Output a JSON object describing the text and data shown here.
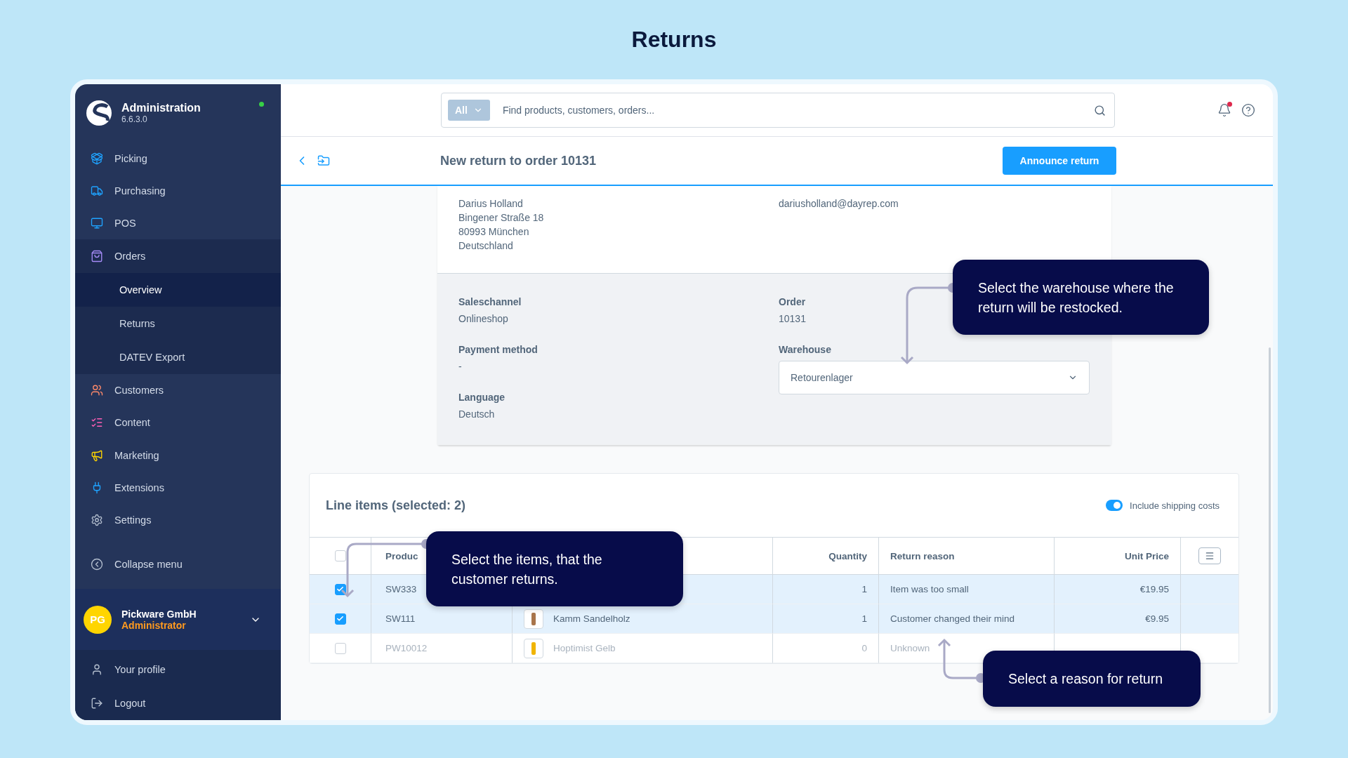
{
  "page_title": "Returns",
  "sidebar": {
    "app_name": "Administration",
    "version": "6.6.3.0",
    "online": true,
    "items": [
      {
        "label": "Picking",
        "selected": false
      },
      {
        "label": "Purchasing",
        "selected": false
      },
      {
        "label": "POS",
        "selected": false
      },
      {
        "label": "Orders",
        "selected": false,
        "expanded": true,
        "children": [
          {
            "label": "Overview",
            "selected": true
          },
          {
            "label": "Returns",
            "selected": false
          },
          {
            "label": "DATEV Export",
            "selected": false
          }
        ]
      },
      {
        "label": "Customers",
        "selected": false
      },
      {
        "label": "Content",
        "selected": false
      },
      {
        "label": "Marketing",
        "selected": false
      },
      {
        "label": "Extensions",
        "selected": false
      },
      {
        "label": "Settings",
        "selected": false
      }
    ],
    "collapse": "Collapse menu",
    "user": {
      "initials": "PG",
      "name": "Pickware GmbH",
      "role": "Administrator"
    },
    "user_links": [
      "Your profile",
      "Logout"
    ]
  },
  "search": {
    "scope": "All",
    "placeholder": "Find products, customers, orders..."
  },
  "notifications": {
    "unread": true
  },
  "header": {
    "title": "New return to order 10131",
    "button": "Announce return"
  },
  "address": {
    "lines": [
      "Darius Holland",
      "Bingener Straße 18",
      "80993 München",
      "Deutschland"
    ],
    "email": "dariusholland@dayrep.com"
  },
  "details": {
    "left": [
      {
        "label": "Saleschannel",
        "value": "Onlineshop"
      },
      {
        "label": "Payment method",
        "value": "-"
      },
      {
        "label": "Language",
        "value": "Deutsch"
      }
    ],
    "order": {
      "label": "Order",
      "value": "10131"
    },
    "warehouse": {
      "label": "Warehouse",
      "value": "Retourenlager"
    }
  },
  "line_items": {
    "title": "Line items (selected: 2)",
    "shipping": {
      "label": "Include shipping costs",
      "on": true
    },
    "all_selected": false,
    "columns": [
      "Produc",
      "Quantity",
      "Return reason",
      "Unit Price"
    ],
    "rows": [
      {
        "number": "SW333",
        "name": "",
        "quantity": "1",
        "reason": "Item was too small",
        "price": "€19.95",
        "selected": true,
        "disabled": false
      },
      {
        "number": "SW111",
        "name": "Kamm Sandelholz",
        "quantity": "1",
        "reason": "Customer changed their mind",
        "price": "€9.95",
        "selected": true,
        "disabled": false
      },
      {
        "number": "PW10012",
        "name": "Hoptimist Gelb",
        "quantity": "0",
        "reason": "Unknown",
        "price": "",
        "selected": false,
        "disabled": true
      }
    ]
  },
  "callouts": [
    "Select the warehouse where the return will be restocked.",
    "Select the items, that the customer returns.",
    "Select a reason for return"
  ]
}
